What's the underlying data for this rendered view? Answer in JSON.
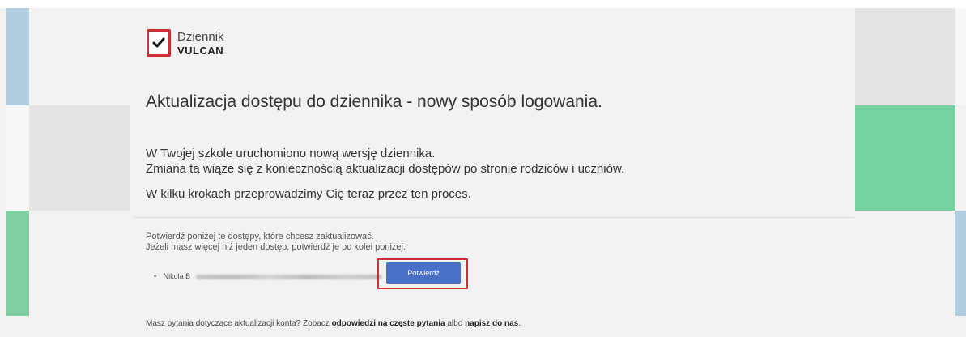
{
  "brand": {
    "name_line1": "Dziennik",
    "name_line2": "VULCAN"
  },
  "title": "Aktualizacja dostępu do dziennika - nowy sposób logowania.",
  "intro": {
    "line1": "W Twojej szkole uruchomiono nową wersję dziennika.",
    "line2": "Zmiana ta wiąże się z koniecznością aktualizacji dostępów po stronie rodziców i uczniów.",
    "line3": "W kilku krokach przeprowadzimy Cię teraz przez ten proces."
  },
  "confirm": {
    "line1": "Potwierdź poniżej te dostępy, które chcesz zaktualizować.",
    "line2": "Jeżeli masz więcej niż jeden dostęp, potwierdź je po kolei poniżej."
  },
  "access": {
    "bullet": "•",
    "name": "Nikola B",
    "button_label": "Potwierdź"
  },
  "footer": {
    "prefix": "Masz pytania dotyczące aktualizacji konta? Zobacz ",
    "faq_link": "odpowiedzi na częste pytania",
    "middle": " albo ",
    "contact_link": "napisz do nas",
    "suffix": "."
  },
  "colors": {
    "button": "#4a6fc6",
    "highlight": "#d62c34",
    "logo_border": "#d22b33",
    "tile_green": "#75d1a1",
    "tile_blue": "#b3cde0"
  },
  "icons": {
    "logo": "checkmark-icon"
  }
}
